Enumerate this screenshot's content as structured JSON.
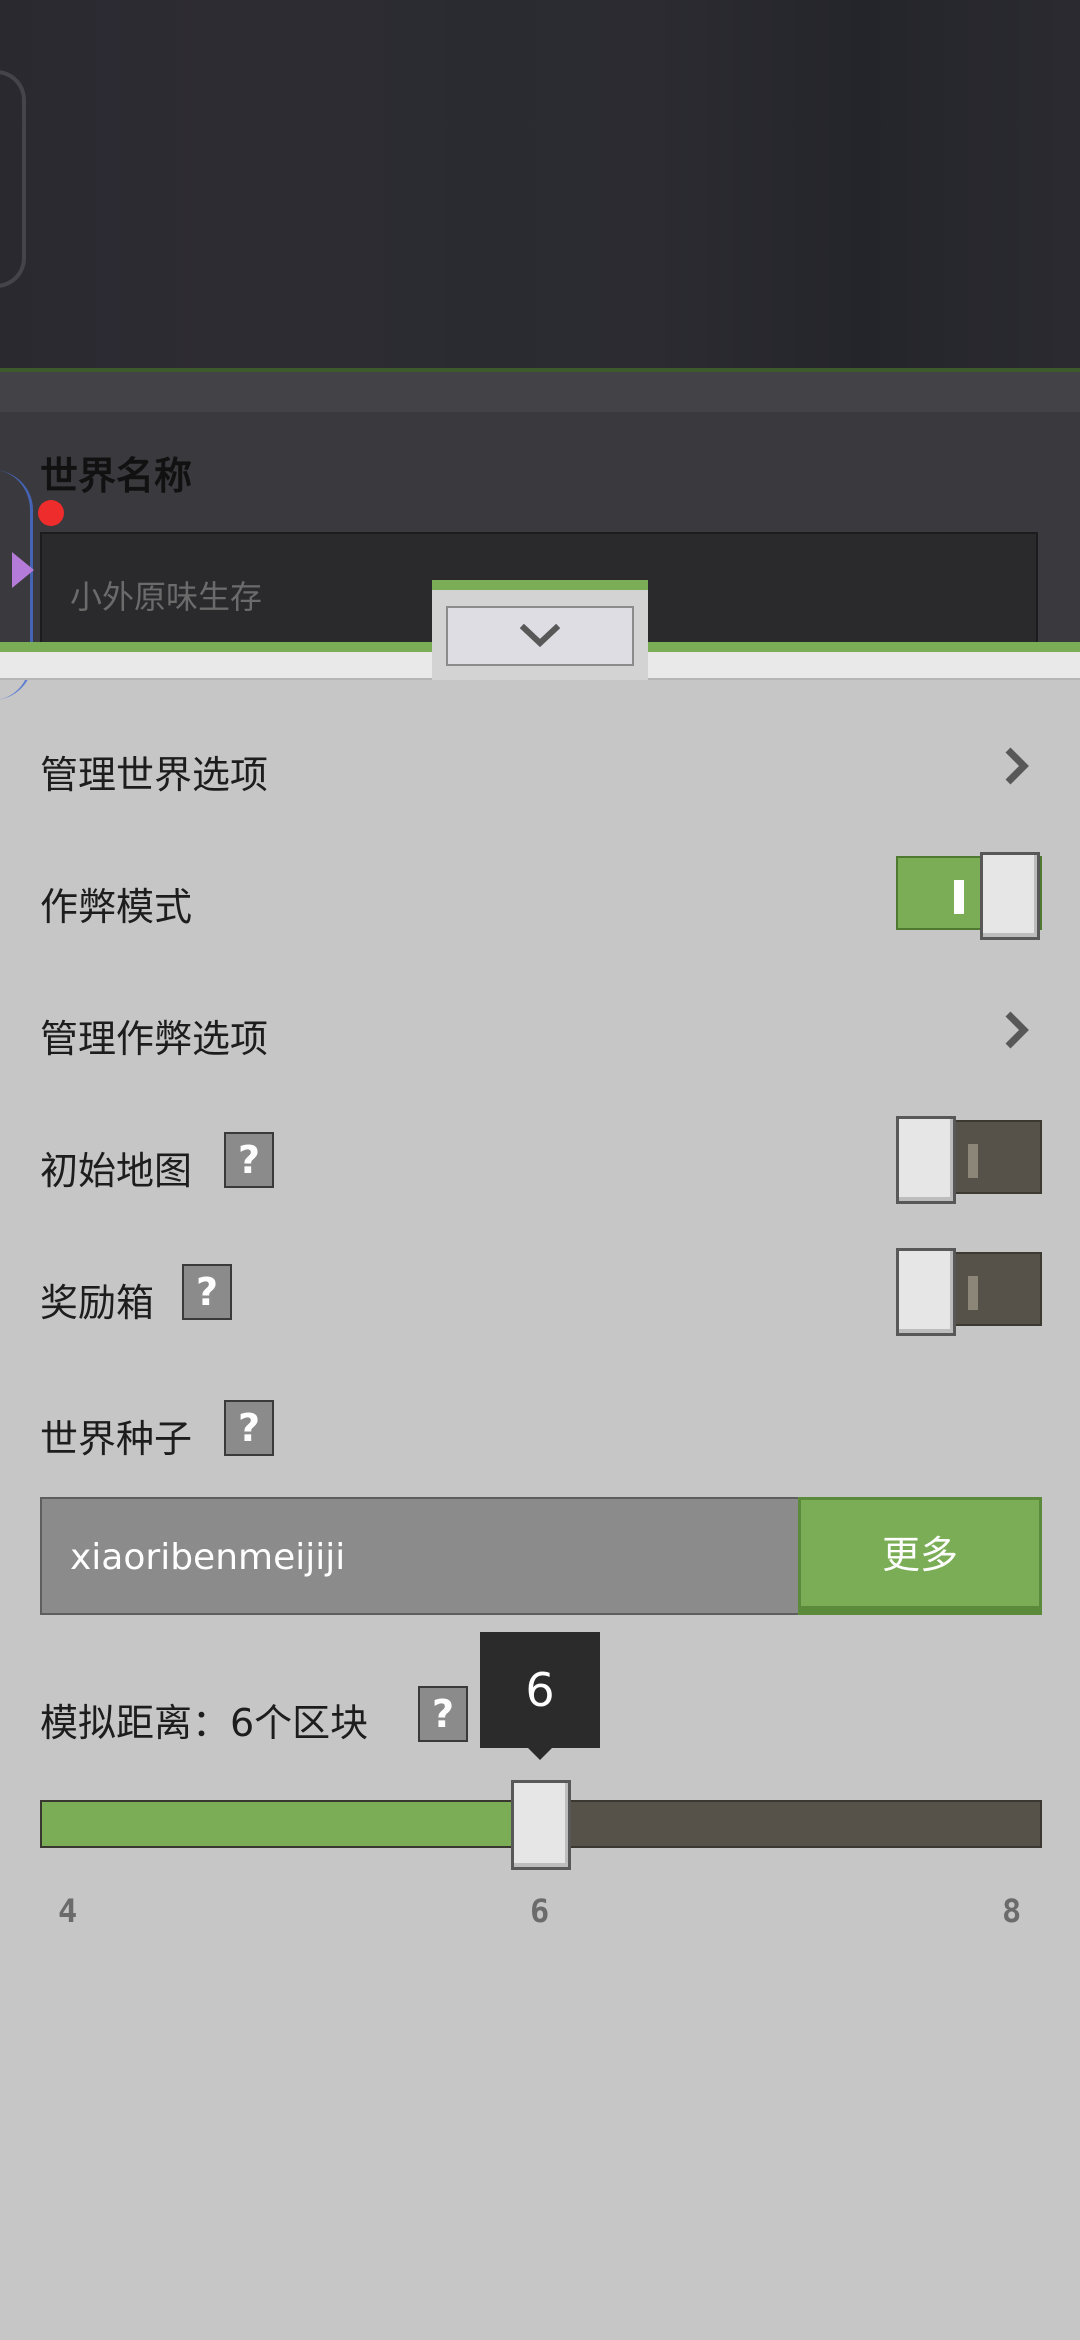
{
  "world_name": {
    "label": "世界名称",
    "value": "小外原味生存"
  },
  "rows": {
    "manage_world": {
      "label": "管理世界选项"
    },
    "cheats": {
      "label": "作弊模式",
      "enabled": true
    },
    "manage_cheats": {
      "label": "管理作弊选项"
    },
    "starting_map": {
      "label": "初始地图",
      "enabled": false,
      "help": "?"
    },
    "bonus_chest": {
      "label": "奖励箱",
      "enabled": false,
      "help": "?"
    },
    "world_seed": {
      "label": "世界种子",
      "help": "?",
      "value": "xiaoribenmeijiji",
      "more_label": "更多"
    }
  },
  "simulation": {
    "label": "模拟距离：6个区块",
    "help": "?",
    "tooltip": "6",
    "min": 4,
    "max": 8,
    "value": 6,
    "ticks": [
      "4",
      "6",
      "8"
    ]
  },
  "colors": {
    "accent_green": "#7aad55",
    "toggle_off": "#56524a",
    "background": "#c6c6c6"
  }
}
